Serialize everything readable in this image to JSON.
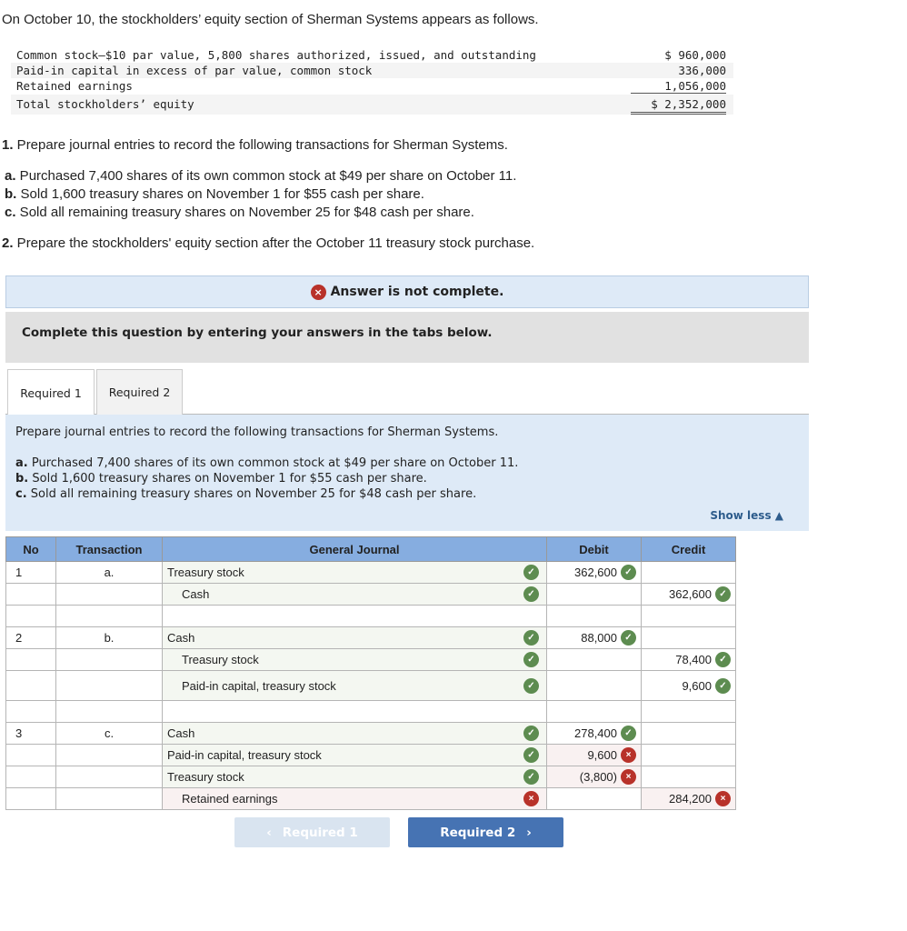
{
  "intro": "On October 10, the stockholders’ equity section of Sherman Systems appears as follows.",
  "equity": {
    "rows": [
      {
        "label": "Common stock—$10 par value, 5,800 shares authorized, issued, and outstanding",
        "amount": "$ 960,000"
      },
      {
        "label": "Paid-in capital in excess of par value, common stock",
        "amount": "336,000"
      },
      {
        "label": "Retained earnings",
        "amount": "1,056,000"
      }
    ],
    "total": {
      "label": "Total stockholders’ equity",
      "amount": "$ 2,352,000"
    }
  },
  "questions": {
    "q1": {
      "num": "1.",
      "text": " Prepare journal entries to record the following transactions for Sherman Systems."
    },
    "items": [
      {
        "letter": "a.",
        "text": " Purchased 7,400 shares of its own common stock at $49 per share on October 11."
      },
      {
        "letter": "b.",
        "text": " Sold 1,600 treasury shares on November 1 for $55 cash per share."
      },
      {
        "letter": "c.",
        "text": " Sold all remaining treasury shares on November 25 for $48 cash per share."
      }
    ],
    "q2": {
      "num": "2.",
      "text": " Prepare the stockholders' equity section after the October 11 treasury stock purchase."
    }
  },
  "banner": {
    "icon": "×",
    "text": "Answer is not complete."
  },
  "instruction": "Complete this question by entering your answers in the tabs below.",
  "tabs": [
    {
      "label": "Required 1",
      "active": true
    },
    {
      "label": "Required 2",
      "active": false
    }
  ],
  "panel": {
    "intro": "Prepare journal entries to record the following transactions for Sherman Systems.",
    "items": [
      {
        "letter": "a.",
        "text": " Purchased 7,400 shares of its own common stock at $49 per share on October 11."
      },
      {
        "letter": "b.",
        "text": " Sold 1,600 treasury shares on November 1 for $55 cash per share."
      },
      {
        "letter": "c.",
        "text": " Sold all remaining treasury shares on November 25 for $48 cash per share."
      }
    ],
    "show_less": "Show less ▲"
  },
  "journal": {
    "headers": {
      "no": "No",
      "transaction": "Transaction",
      "general_journal": "General Journal",
      "debit": "Debit",
      "credit": "Credit"
    },
    "rows": [
      {
        "no": "1",
        "tr": "a.",
        "account": "Treasury stock",
        "indent": false,
        "acct_status": "ok",
        "debit": "362,600",
        "debit_status": "ok",
        "credit": "",
        "credit_status": ""
      },
      {
        "no": "",
        "tr": "",
        "account": "Cash",
        "indent": true,
        "acct_status": "ok",
        "debit": "",
        "debit_status": "",
        "credit": "362,600",
        "credit_status": "ok"
      },
      {
        "no": "",
        "tr": "",
        "account": "",
        "indent": false,
        "acct_status": "",
        "debit": "",
        "debit_status": "",
        "credit": "",
        "credit_status": "",
        "spacer": true
      },
      {
        "no": "2",
        "tr": "b.",
        "account": "Cash",
        "indent": false,
        "acct_status": "ok",
        "debit": "88,000",
        "debit_status": "ok",
        "credit": "",
        "credit_status": ""
      },
      {
        "no": "",
        "tr": "",
        "account": "Treasury stock",
        "indent": true,
        "acct_status": "ok",
        "debit": "",
        "debit_status": "",
        "credit": "78,400",
        "credit_status": "ok"
      },
      {
        "no": "",
        "tr": "",
        "account": "Paid-in capital, treasury stock",
        "indent": true,
        "acct_status": "ok",
        "debit": "",
        "debit_status": "",
        "credit": "9,600",
        "credit_status": "ok",
        "tall": true
      },
      {
        "no": "",
        "tr": "",
        "account": "",
        "indent": false,
        "acct_status": "",
        "debit": "",
        "debit_status": "",
        "credit": "",
        "credit_status": "",
        "spacer": true
      },
      {
        "no": "3",
        "tr": "c.",
        "account": "Cash",
        "indent": false,
        "acct_status": "ok",
        "debit": "278,400",
        "debit_status": "ok",
        "credit": "",
        "credit_status": ""
      },
      {
        "no": "",
        "tr": "",
        "account": "Paid-in capital, treasury stock",
        "indent": false,
        "acct_status": "ok",
        "debit": "9,600",
        "debit_status": "bad",
        "credit": "",
        "credit_status": ""
      },
      {
        "no": "",
        "tr": "",
        "account": "Treasury stock",
        "indent": false,
        "acct_status": "ok",
        "debit": "(3,800)",
        "debit_status": "bad",
        "credit": "",
        "credit_status": ""
      },
      {
        "no": "",
        "tr": "",
        "account": "Retained earnings",
        "indent": true,
        "acct_status": "bad",
        "debit": "",
        "debit_status": "",
        "credit": "284,200",
        "credit_status": "bad"
      }
    ]
  },
  "nav": {
    "prev": "Required 1",
    "prev_icon": "‹",
    "next": "Required 2",
    "next_icon": "›"
  },
  "colors": {
    "header_blue": "#86ade0",
    "ok_green": "#5d8c50",
    "bad_red": "#b8322a",
    "next_button": "#4673b3",
    "panel_blue": "#deeaf7"
  }
}
